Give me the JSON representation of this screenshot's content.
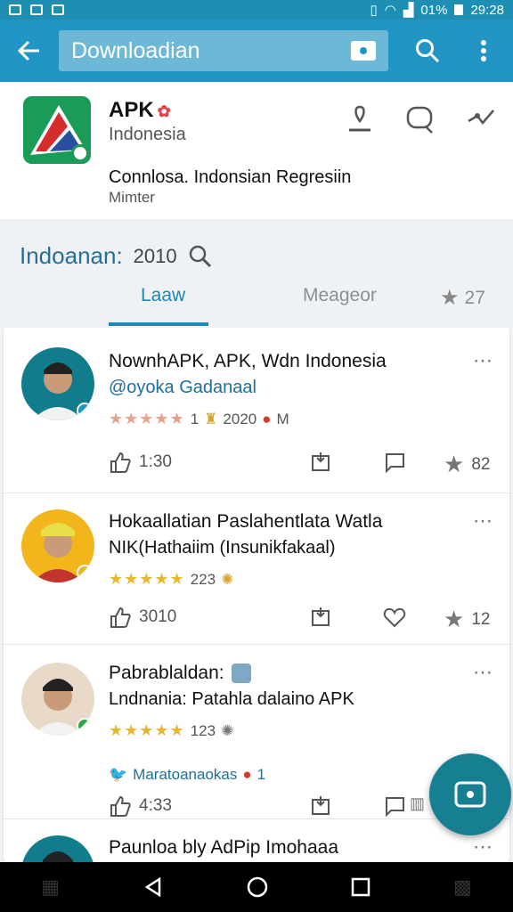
{
  "status_bar": {
    "battery_pct": "01%",
    "time": "29:28"
  },
  "search": {
    "query": "Downloadian"
  },
  "app": {
    "name": "APK",
    "country": "Indonesia",
    "description": "Connlosa. Indonsian Regresiin",
    "meta": "Mimter"
  },
  "filter": {
    "label": "Indoanan:",
    "value": "2010"
  },
  "tabs": [
    {
      "label": "Laaw"
    },
    {
      "label": "Meageor"
    },
    {
      "label": "27"
    }
  ],
  "posts": [
    {
      "title": "NownhAPK, APK, Wdn Indonesia",
      "subtitle": "@oyoka Gadanaal",
      "rating_text": "1",
      "rating_count": "2020",
      "extra": "M",
      "likes": "1:30",
      "stars": "82"
    },
    {
      "title": "Hokaallatian Paslahentlata Watla",
      "subtitle": "NIK(Hathaiim (Insunikfakaal)",
      "rating_count": "223",
      "likes": "3010",
      "stars": "12"
    },
    {
      "title": "Pabrablaldan:",
      "subtitle": "Lndnania: Patahla dalaino APK",
      "rating_count": "123",
      "twitter_handle": "Maratoanaokas",
      "twitter_count": "1",
      "likes": "4:33"
    },
    {
      "title": "Paunloa bly AdPip Imohaaa"
    }
  ],
  "colors": {
    "primary": "#2196c4",
    "accent": "#177f92",
    "link": "#1e6f9c",
    "star": "#e6b82f"
  }
}
